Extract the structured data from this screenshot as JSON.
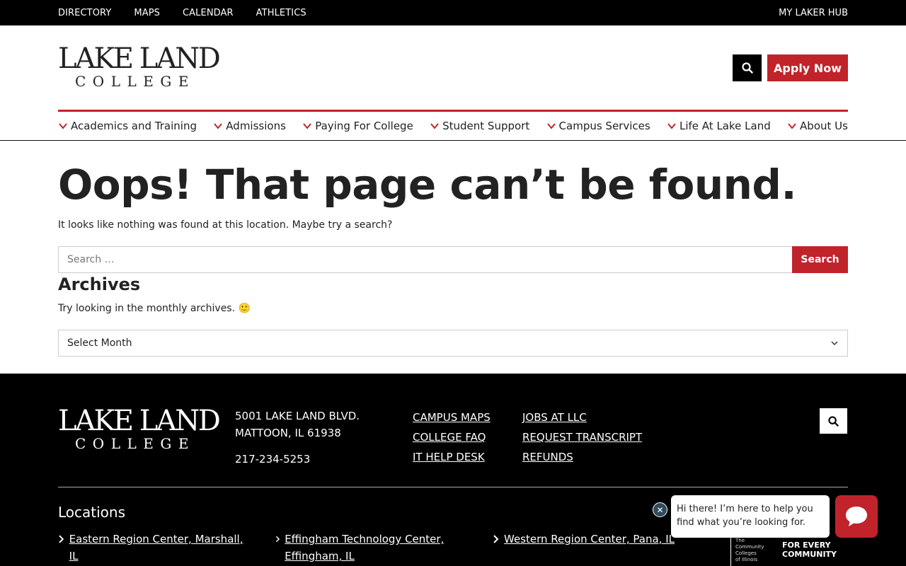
{
  "topbar": {
    "links": [
      "DIRECTORY",
      "MAPS",
      "CALENDAR",
      "ATHLETICS"
    ],
    "hub": "MY LAKER HUB"
  },
  "logo": {
    "line1": "LAKE LAND",
    "line2": "COLLEGE"
  },
  "header": {
    "apply_label": "Apply Now",
    "search_icon": "search-icon"
  },
  "nav": {
    "items": [
      "Academics and Training",
      "Admissions",
      "Paying For College",
      "Student Support",
      "Campus Services",
      "Life At Lake Land",
      "About Us"
    ]
  },
  "content": {
    "title": "Oops! That page can’t be found.",
    "subtitle": "It looks like nothing was found at this location. Maybe try a search?",
    "search_placeholder": "Search …",
    "search_button": "Search",
    "archives_title": "Archives",
    "archives_text": "Try looking in the monthly archives. 🙂",
    "select_value": "Select Month"
  },
  "footer": {
    "address_line1": "5001 LAKE LAND BLVD.",
    "address_line2": "MATTOON, IL 61938",
    "phone": "217-234-5253",
    "col1": [
      "CAMPUS MAPS",
      "COLLEGE FAQ",
      "IT HELP DESK"
    ],
    "col2": [
      "JOBS AT LLC",
      "REQUEST TRANSCRIPT",
      "REFUNDS"
    ],
    "locations_title": "Locations",
    "locations": [
      "Eastern Region Center, Marshall, IL",
      "Effingham Technology Center, Effingham, IL",
      "Western Region Center, Pana, IL"
    ],
    "iccb_small": [
      "The",
      "Community",
      "Colleges",
      "of Illinois"
    ],
    "iccb_big": [
      "FOR EVERY",
      "COMMUNITY"
    ]
  },
  "chat": {
    "message": "Hi there! I’m here to help you find what you’re looking for.",
    "close_glyph": "✕"
  },
  "colors": {
    "brand_red": "#c1232b",
    "black": "#000000"
  }
}
